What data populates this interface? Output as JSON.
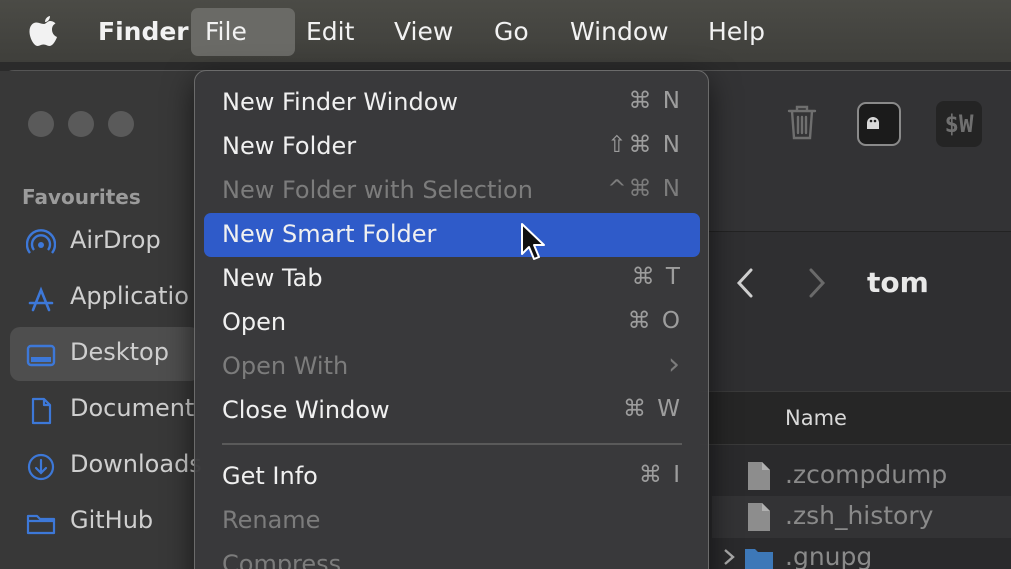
{
  "menubar": {
    "app_name": "Finder",
    "items": [
      "File",
      "Edit",
      "View",
      "Go",
      "Window",
      "Help"
    ],
    "active": "File"
  },
  "sidebar": {
    "header": "Favourites",
    "items": [
      {
        "label": "AirDrop",
        "icon": "airdrop-icon"
      },
      {
        "label": "Applicatio",
        "icon": "applications-icon"
      },
      {
        "label": "Desktop",
        "icon": "desktop-icon",
        "selected": true
      },
      {
        "label": "Document",
        "icon": "document-icon"
      },
      {
        "label": "Downloads",
        "icon": "downloads-icon"
      },
      {
        "label": "GitHub",
        "icon": "folder-icon"
      }
    ]
  },
  "toolbar": {
    "extension_label": "$W"
  },
  "browser": {
    "folder_title": "tom",
    "column_name": "Name",
    "files": [
      {
        "name": ".zcompdump",
        "icon": "file-icon"
      },
      {
        "name": ".zsh_history",
        "icon": "file-icon"
      },
      {
        "name": ".gnupg",
        "icon": "folder-icon"
      }
    ]
  },
  "file_menu": {
    "items": [
      {
        "label": "New Finder Window",
        "shortcut": "⌘ N",
        "enabled": true
      },
      {
        "label": "New Folder",
        "shortcut": "⇧⌘ N",
        "enabled": true
      },
      {
        "label": "New Folder with Selection",
        "shortcut": "^⌘ N",
        "enabled": false
      },
      {
        "label": "New Smart Folder",
        "shortcut": "",
        "enabled": true,
        "highlighted": true
      },
      {
        "label": "New Tab",
        "shortcut": "⌘ T",
        "enabled": true
      },
      {
        "label": "Open",
        "shortcut": "⌘ O",
        "enabled": true
      },
      {
        "label": "Open With",
        "shortcut": "›",
        "enabled": false
      },
      {
        "label": "Close Window",
        "shortcut": "⌘ W",
        "enabled": true
      },
      {
        "label": "Get Info",
        "shortcut": "⌘ I",
        "enabled": true
      },
      {
        "label": "Rename",
        "shortcut": "",
        "enabled": false
      },
      {
        "label": "Compress",
        "shortcut": "",
        "enabled": false
      }
    ]
  },
  "colors": {
    "highlight": "#2f5bc9",
    "menubar": "#45453f",
    "menu_bg": "#3a3a3c"
  }
}
